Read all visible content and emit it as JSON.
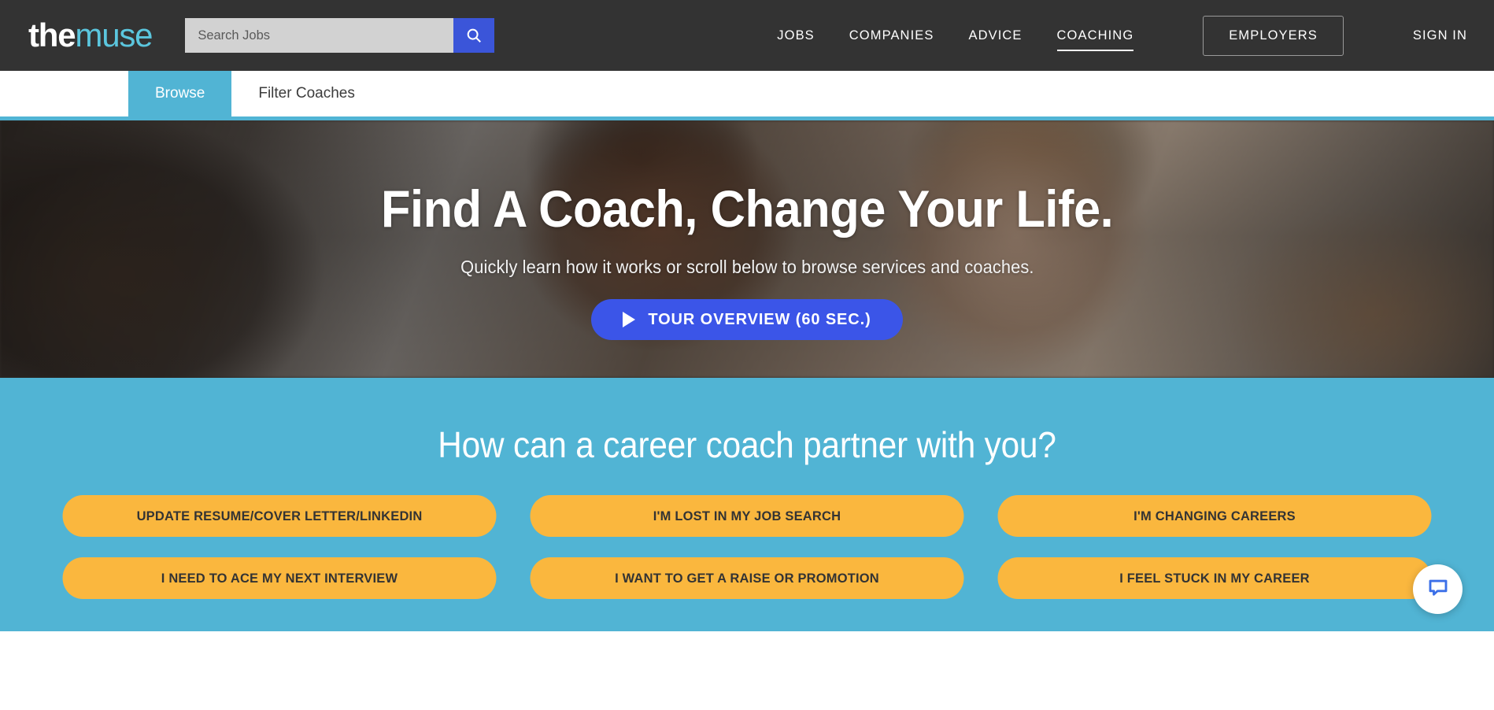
{
  "brand": {
    "logo_the": "the",
    "logo_muse": "muse",
    "accent_teal": "#51b4d4",
    "accent_blue": "#3b55e8",
    "accent_orange": "#fab73e",
    "header_bg": "#333333"
  },
  "header": {
    "search": {
      "value": "",
      "placeholder": "Search Jobs",
      "icon": "search-icon"
    },
    "nav": [
      {
        "label": "JOBS",
        "active": false
      },
      {
        "label": "COMPANIES",
        "active": false
      },
      {
        "label": "ADVICE",
        "active": false
      },
      {
        "label": "COACHING",
        "active": true
      }
    ],
    "employers_label": "EMPLOYERS",
    "signin_label": "SIGN IN"
  },
  "subnav": {
    "tabs": [
      {
        "label": "Browse",
        "active": true
      },
      {
        "label": "Filter Coaches",
        "active": false
      }
    ]
  },
  "hero": {
    "title": "Find A Coach, Change Your Life.",
    "subtitle": "Quickly learn how it works or scroll below to browse services and coaches.",
    "cta_label": "TOUR OVERVIEW (60 SEC.)",
    "cta_icon": "play-icon"
  },
  "services": {
    "heading": "How can a career coach partner with you?",
    "pills": [
      "UPDATE RESUME/COVER LETTER/LINKEDIN",
      "I'M LOST IN MY JOB SEARCH",
      "I'M CHANGING CAREERS",
      "I NEED TO ACE MY NEXT INTERVIEW",
      "I WANT TO GET A RAISE OR PROMOTION",
      "I FEEL STUCK IN MY CAREER"
    ]
  },
  "chat": {
    "icon": "chat-bubble-icon"
  }
}
